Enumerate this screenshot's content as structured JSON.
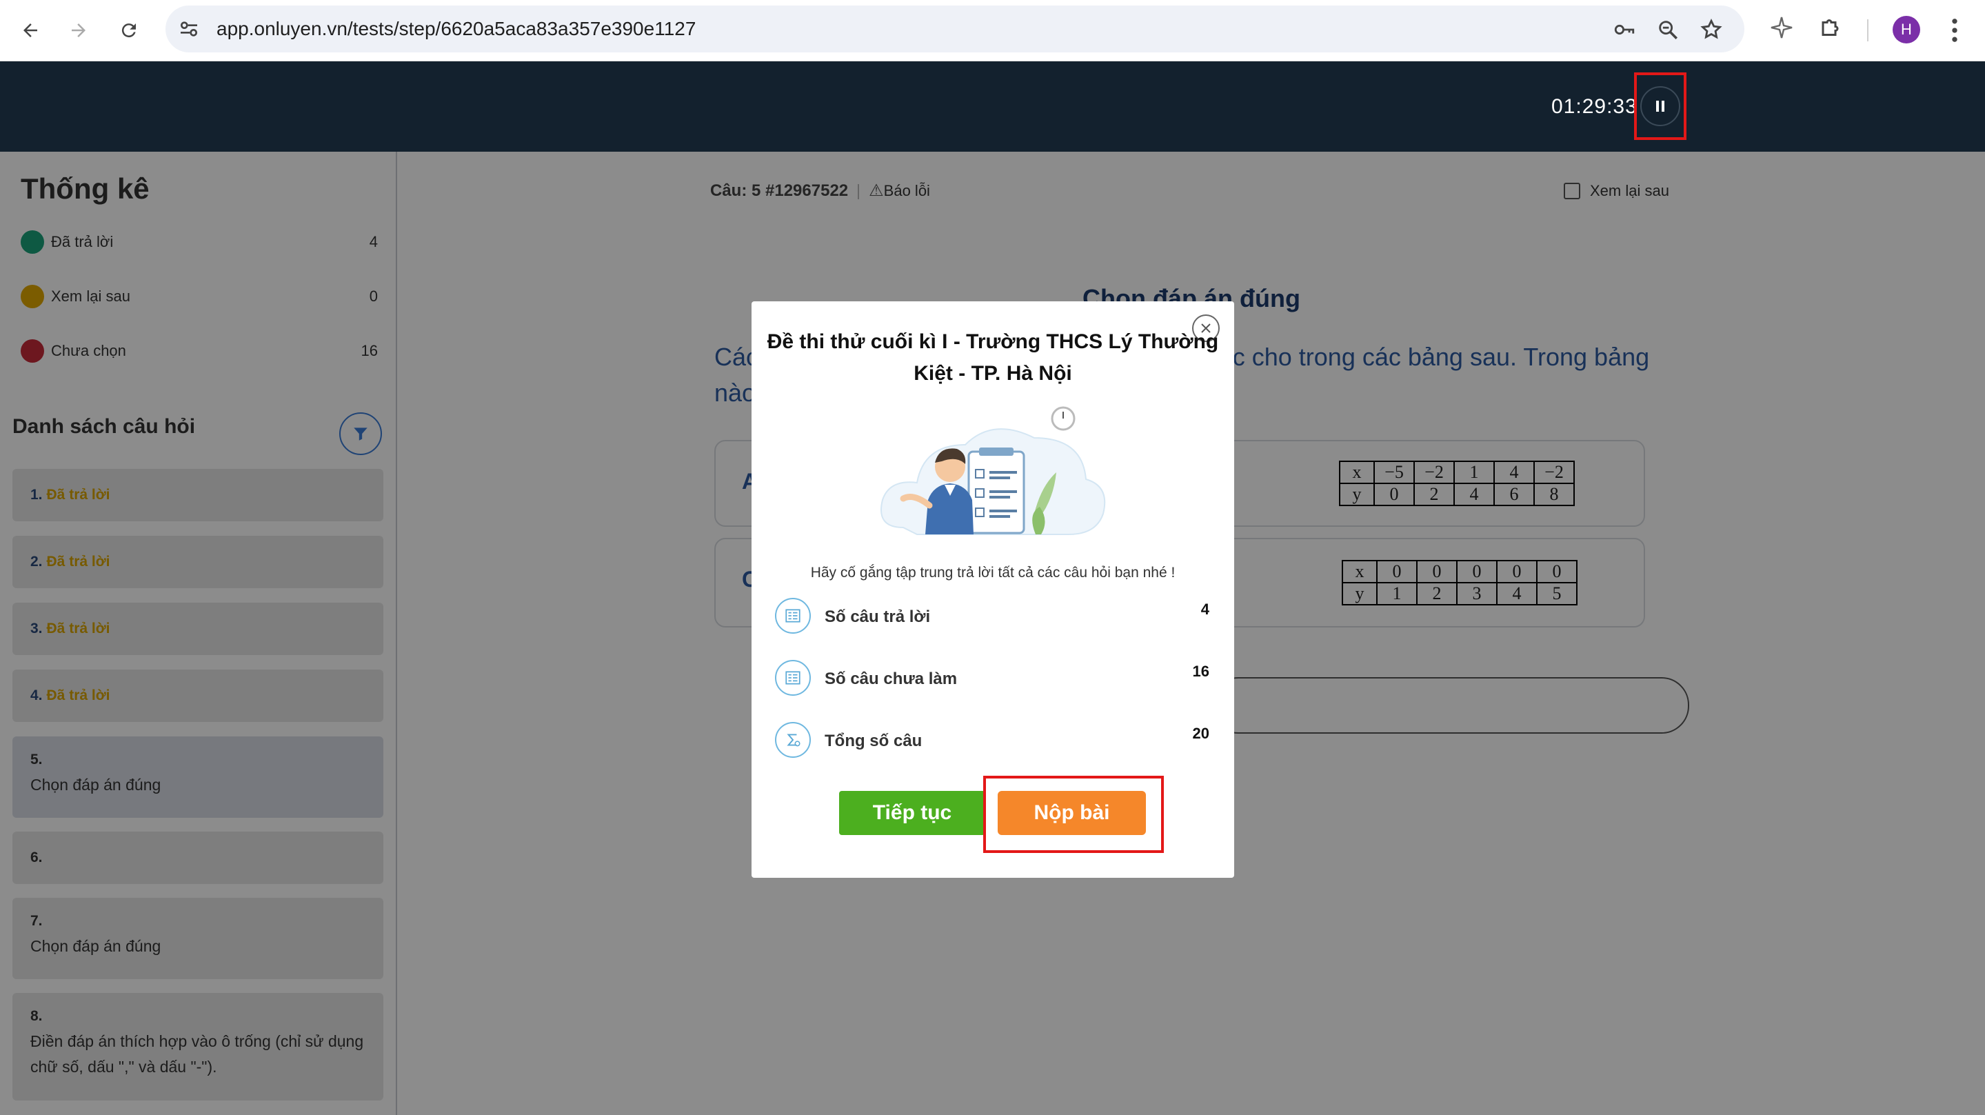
{
  "browser": {
    "url": "app.onluyen.vn/tests/step/6620a5aca83a357e390e1127",
    "avatar_letter": "H"
  },
  "header": {
    "timer": "01:29:33"
  },
  "sidebar": {
    "stats_title": "Thống kê",
    "stats": [
      {
        "label": "Đã trả lời",
        "count": "4",
        "color": "#1ba37a"
      },
      {
        "label": "Xem lại sau",
        "count": "0",
        "color": "#e0a800"
      },
      {
        "label": "Chưa chọn",
        "count": "16",
        "color": "#c62a3a"
      }
    ],
    "list_title": "Danh sách câu hỏi",
    "questions": [
      {
        "num": "1.",
        "status": "Đã trả lời"
      },
      {
        "num": "2.",
        "status": "Đã trả lời"
      },
      {
        "num": "3.",
        "status": "Đã trả lời"
      },
      {
        "num": "4.",
        "status": "Đã trả lời"
      },
      {
        "num": "5.",
        "text": "Chọn đáp án đúng"
      },
      {
        "num": "6.",
        "text": ""
      },
      {
        "num": "7.",
        "text": "Chọn đáp án đúng"
      },
      {
        "num": "8.",
        "text": "Điền đáp án thích hợp vào ô trống (chỉ sử dụng chữ số, dấu \",\" và dấu \"-\")."
      }
    ]
  },
  "main": {
    "question_label": "Câu: 5 #12967522",
    "report_label": "Báo lỗi",
    "review_later_label": "Xem lại sau",
    "choose_title": "Chọn đáp án đúng",
    "question_text_left": "Các",
    "question_text_right": "ược cho trong các bảng sau. Trong bảng",
    "question_text_line2": "nào",
    "answers": [
      {
        "letter": "A",
        "x": [
          "x",
          "−5",
          "−2",
          "1",
          "4",
          "−2"
        ],
        "y": [
          "y",
          "0",
          "2",
          "4",
          "6",
          "8"
        ]
      },
      {
        "letter": "C",
        "x": [
          "x",
          "0",
          "0",
          "0",
          "0",
          "0"
        ],
        "y": [
          "y",
          "1",
          "2",
          "3",
          "4",
          "5"
        ]
      }
    ]
  },
  "modal": {
    "title": "Đề thi thử cuối kì I - Trường THCS Lý Thường Kiệt - TP. Hà Nội",
    "encourage": "Hãy cố gắng tập trung trả lời tất cả các câu hỏi bạn nhé !",
    "stats": [
      {
        "label": "Số câu trả lời",
        "value": "4"
      },
      {
        "label": "Số câu chưa làm",
        "value": "16"
      },
      {
        "label": "Tổng số câu",
        "value": "20"
      }
    ],
    "continue_label": "Tiếp tục",
    "submit_label": "Nộp bài"
  }
}
